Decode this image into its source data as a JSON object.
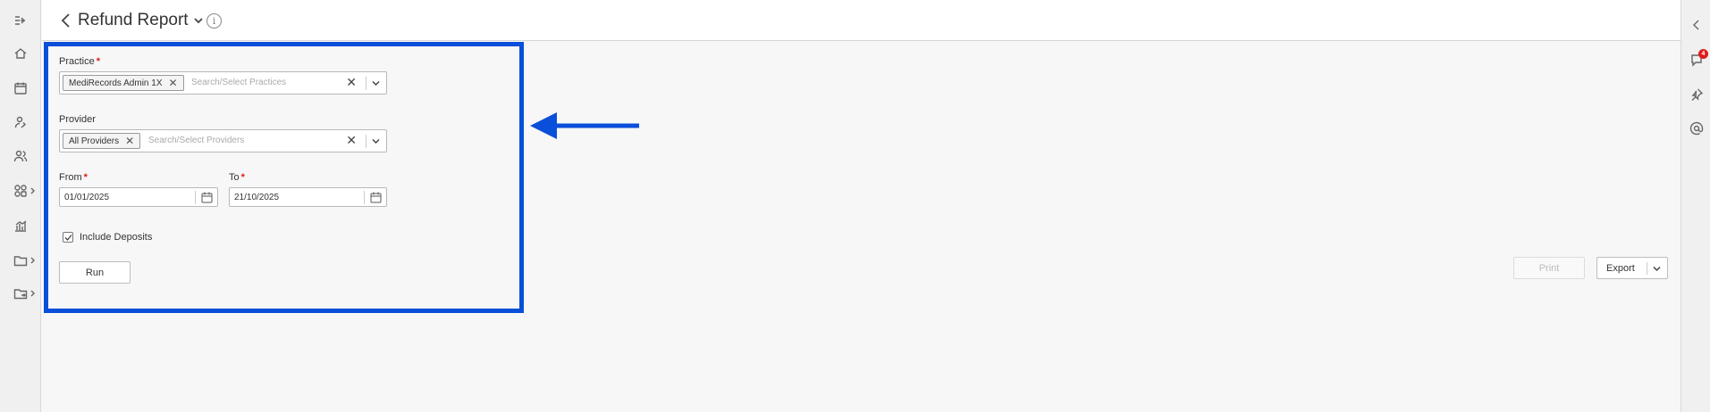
{
  "header": {
    "title": "Refund Report"
  },
  "left_nav": {
    "items": [
      {
        "icon": "collapse-icon"
      },
      {
        "icon": "home-icon"
      },
      {
        "icon": "calendar-icon"
      },
      {
        "icon": "patients-icon"
      },
      {
        "icon": "users-icon"
      },
      {
        "icon": "modules-icon"
      },
      {
        "icon": "reports-icon"
      },
      {
        "icon": "folder-icon"
      },
      {
        "icon": "folder-share-icon"
      }
    ]
  },
  "right_rail": {
    "notification_count": "4"
  },
  "form": {
    "practice": {
      "label": "Practice",
      "required": "*",
      "selected": "MediRecords Admin 1X",
      "placeholder": "Search/Select Practices"
    },
    "provider": {
      "label": "Provider",
      "selected": "All Providers",
      "placeholder": "Search/Select Providers"
    },
    "from": {
      "label": "From",
      "required": "*",
      "value": "01/01/2025"
    },
    "to": {
      "label": "To",
      "required": "*",
      "value": "21/10/2025"
    },
    "include_deposits": {
      "label": "Include Deposits",
      "checked": true
    },
    "run_label": "Run"
  },
  "actions": {
    "print_label": "Print",
    "export_label": "Export"
  },
  "colors": {
    "highlight": "#0a4fd9",
    "required": "#e01b1b"
  }
}
